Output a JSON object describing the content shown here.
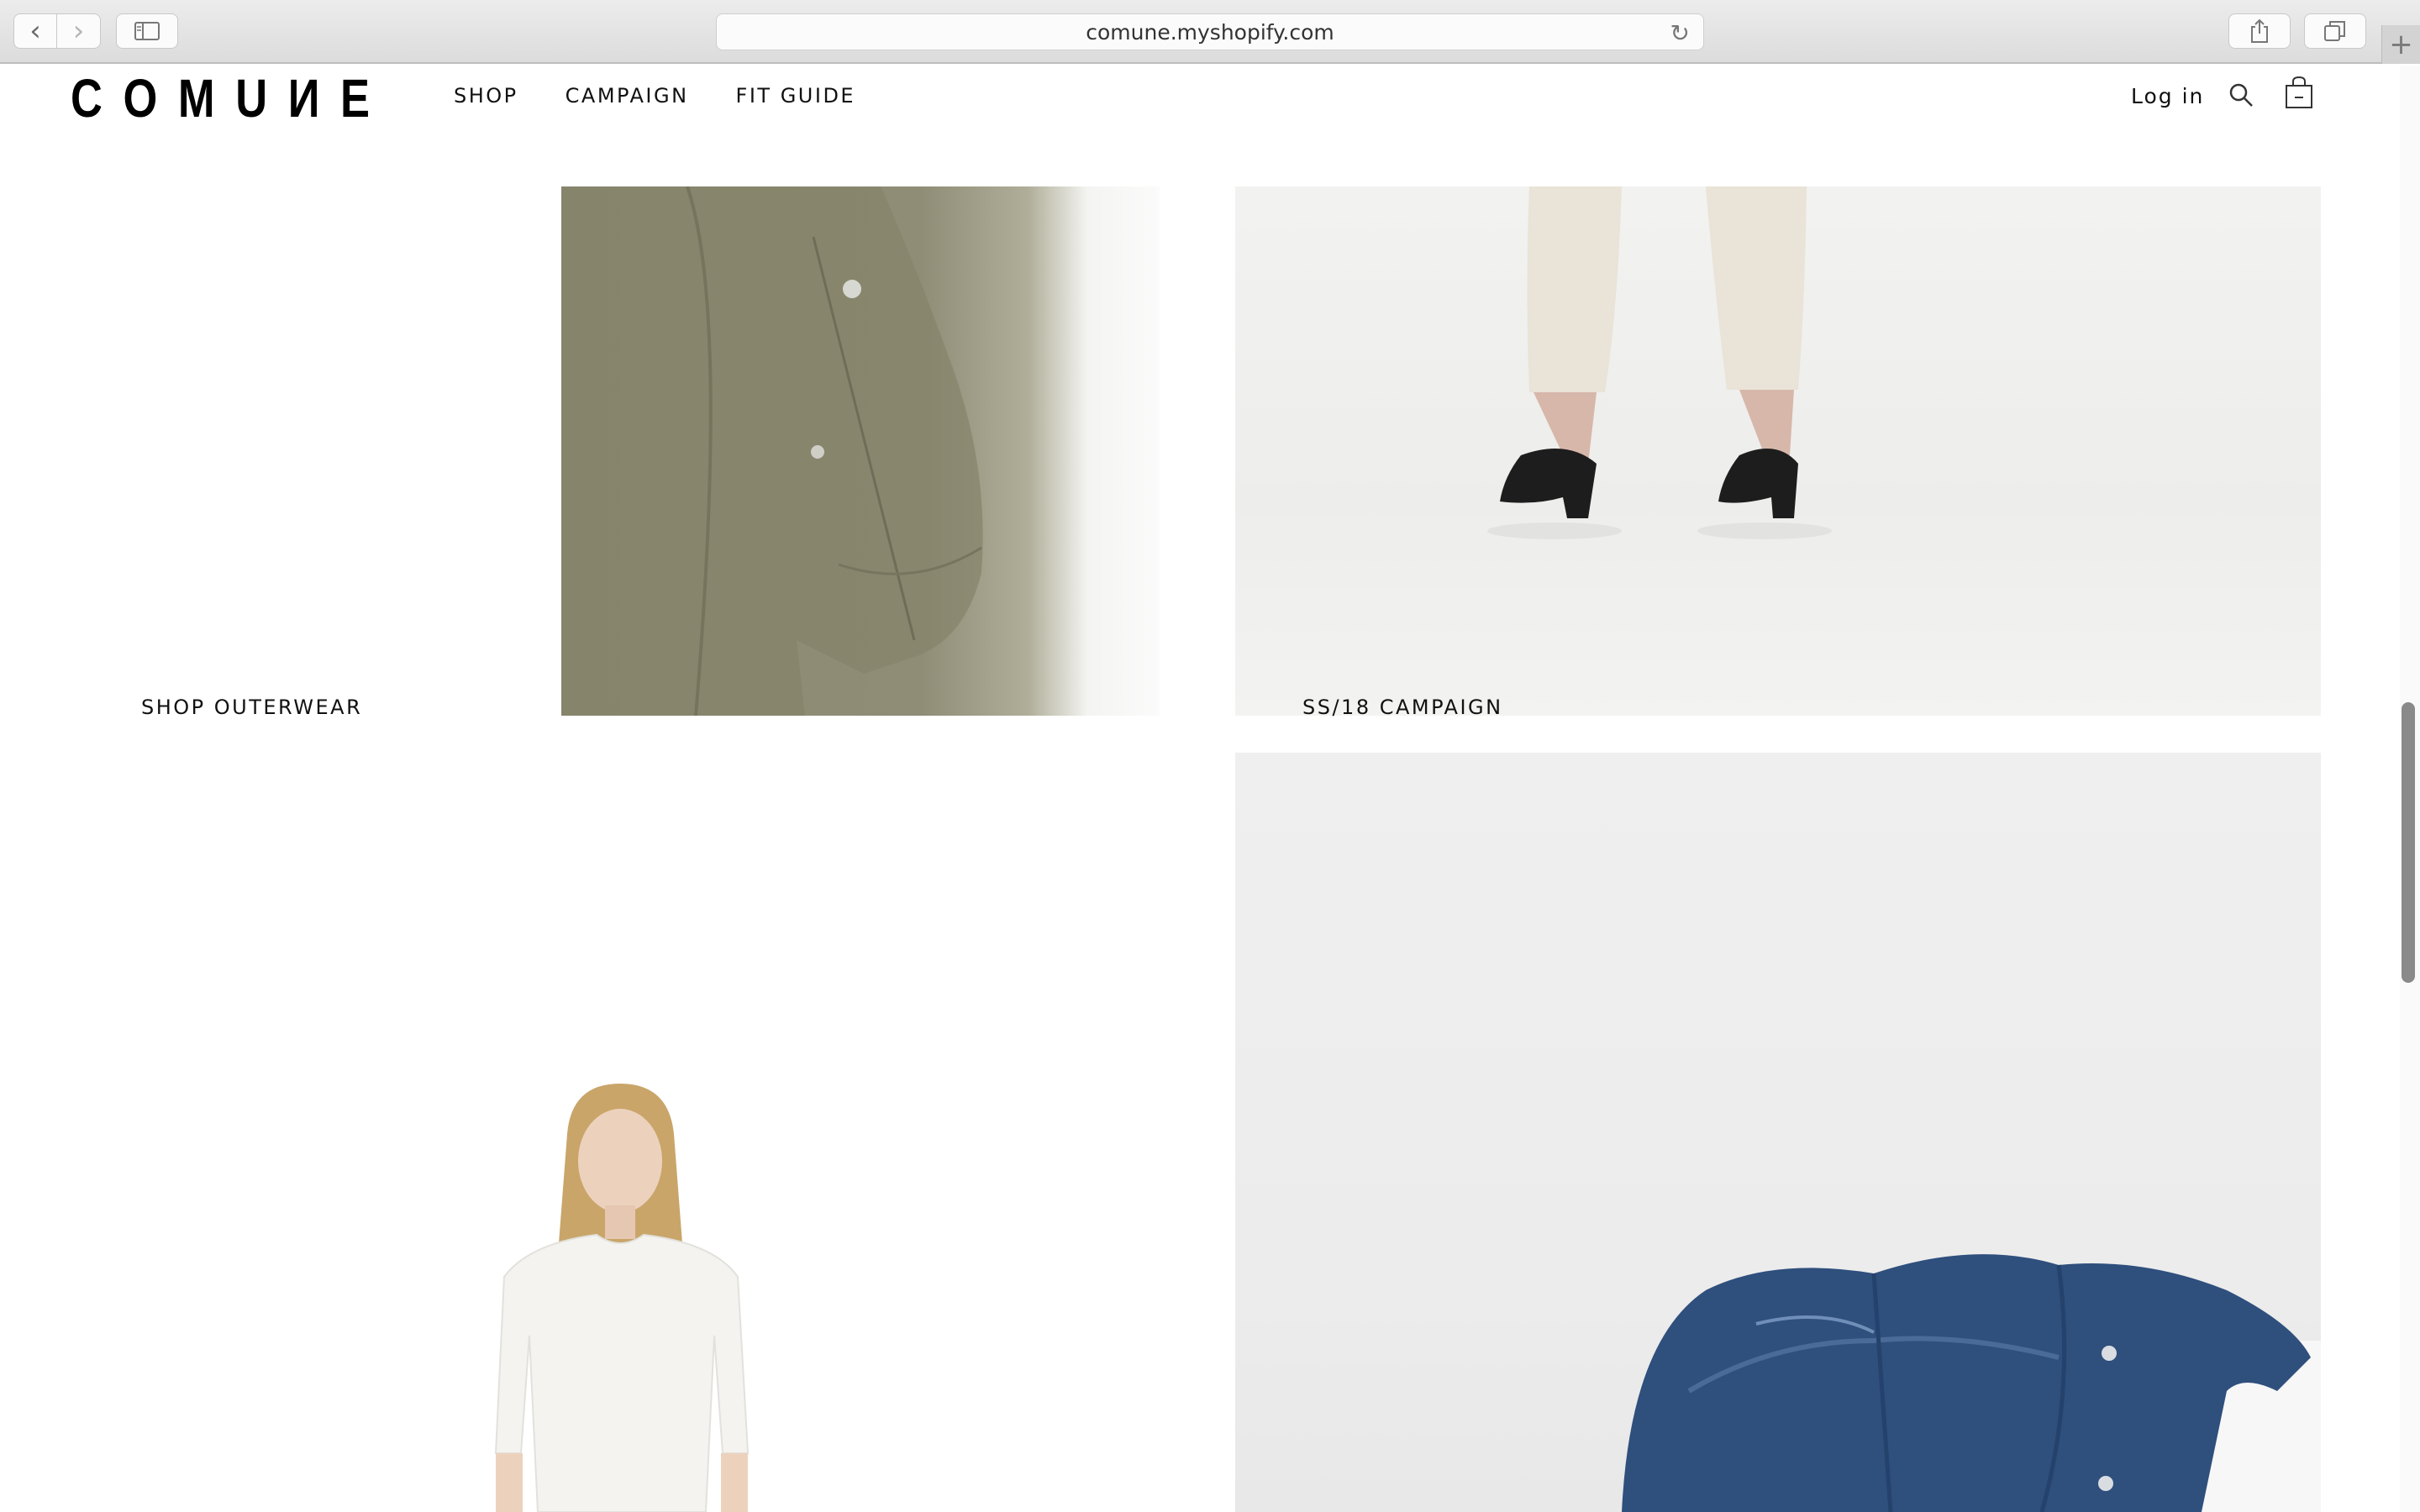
{
  "browser": {
    "url": "comune.myshopify.com",
    "back_glyph": "‹",
    "forward_glyph": "›",
    "reload_glyph": "↻",
    "new_tab_glyph": "+"
  },
  "site": {
    "logo": "COMUИE",
    "nav": [
      "SHOP",
      "CAMPAIGN",
      "FIT GUIDE"
    ],
    "login_label": "Log in",
    "icons": {
      "search": "search-icon",
      "cart": "shopping-bag-icon"
    }
  },
  "sections": {
    "outerwear_label": "SHOP OUTERWEAR",
    "campaign_label": "SS/18 CAMPAIGN"
  },
  "colors": {
    "text": "#111111",
    "background": "#ffffff",
    "olive": "#8b8a72",
    "denim": "#2f4f7d"
  }
}
